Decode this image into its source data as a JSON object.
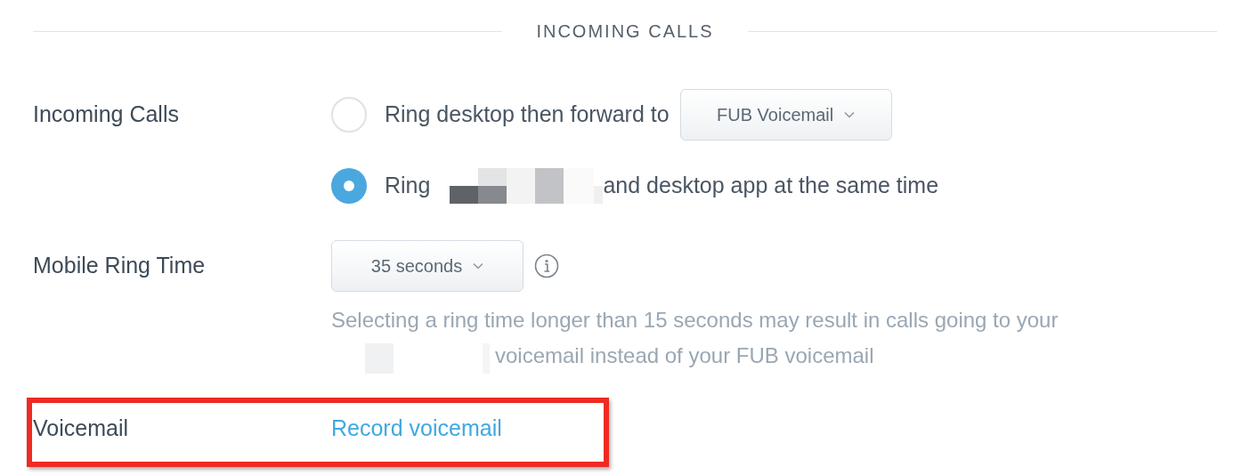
{
  "section_title": "INCOMING CALLS",
  "incoming_calls": {
    "label": "Incoming Calls",
    "options": [
      {
        "kind": "forward",
        "text_before": "Ring desktop then forward to",
        "select": "FUB Voicemail",
        "selected": false
      },
      {
        "kind": "simultaneous",
        "text_before": "Ring",
        "redacted": true,
        "text_after": "and desktop app at the same time",
        "selected": true
      }
    ]
  },
  "mobile_ring_time": {
    "label": "Mobile Ring Time",
    "select": "35 seconds",
    "help_lines": [
      "Selecting a ring time longer than 15 seconds may result in calls going to your",
      "voicemail instead of your FUB voicemail"
    ]
  },
  "voicemail": {
    "label": "Voicemail",
    "link": "Record voicemail",
    "highlighted": true
  }
}
